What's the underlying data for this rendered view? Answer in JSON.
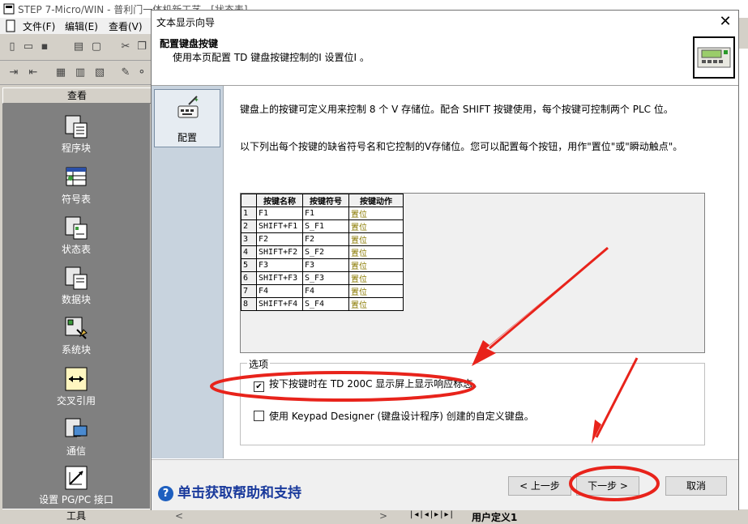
{
  "app": {
    "title": "STEP 7-Micro/WIN - 普利门一体机新工艺 - [状态表]",
    "menus": [
      "文件(F)",
      "编辑(E)",
      "查看(V)"
    ],
    "nav_header": "查看",
    "nav_items": [
      {
        "label": "程序块",
        "icon": "program-block-icon"
      },
      {
        "label": "符号表",
        "icon": "symbol-table-icon"
      },
      {
        "label": "状态表",
        "icon": "status-table-icon"
      },
      {
        "label": "数据块",
        "icon": "data-block-icon"
      },
      {
        "label": "系统块",
        "icon": "system-block-icon"
      },
      {
        "label": "交叉引用",
        "icon": "cross-reference-icon"
      },
      {
        "label": "通信",
        "icon": "communication-icon"
      },
      {
        "label": "设置 PG/PC 接口",
        "icon": "pgpc-interface-icon"
      }
    ],
    "nav_footer": "工具",
    "bottom_tab": "用户定义1"
  },
  "dialog": {
    "title": "文本显示向导",
    "header_title": "配置键盘按键",
    "header_subtitle": "使用本页配置 TD 键盘按键控制的I 设置位I 。",
    "side_button": "配置",
    "para1": "键盘上的按键可定义用来控制 8 个 V 存储位。配合 SHIFT 按键使用，每个按键可控制两个 PLC 位。",
    "para2": "以下列出每个按键的缺省符号名和它控制的V存储位。您可以配置每个按钮，用作\"置位\"或\"瞬动触点\"。",
    "table": {
      "headers": [
        "按键名称",
        "按键符号",
        "按键动作"
      ],
      "rows": [
        [
          "1",
          "F1",
          "F1",
          "置位"
        ],
        [
          "2",
          "SHIFT+F1",
          "S_F1",
          "置位"
        ],
        [
          "3",
          "F2",
          "F2",
          "置位"
        ],
        [
          "4",
          "SHIFT+F2",
          "S_F2",
          "置位"
        ],
        [
          "5",
          "F3",
          "F3",
          "置位"
        ],
        [
          "6",
          "SHIFT+F3",
          "S_F3",
          "置位"
        ],
        [
          "7",
          "F4",
          "F4",
          "置位"
        ],
        [
          "8",
          "SHIFT+F4",
          "S_F4",
          "置位"
        ]
      ]
    },
    "options_label": "选项",
    "option1": {
      "label": "按下按键时在 TD 200C 显示屏上显示响应标志。",
      "checked": true
    },
    "option2": {
      "label": "使用 Keypad Designer (键盘设计程序) 创建的自定义键盘。",
      "checked": false
    },
    "help_link": "单击获取帮助和支持",
    "buttons": {
      "back": "< 上一步",
      "next": "下一步 >",
      "cancel": "取消"
    }
  },
  "colors": {
    "annotation_red": "#e8231b",
    "help_blue": "#1a3a9c"
  }
}
